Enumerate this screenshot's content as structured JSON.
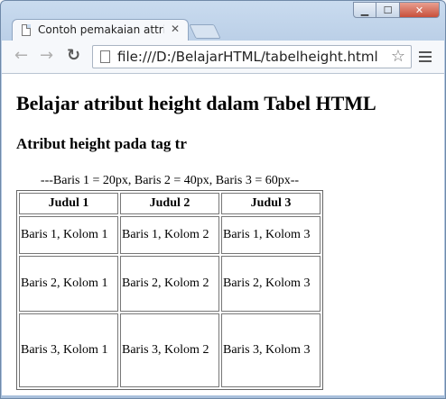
{
  "browser": {
    "tab_title": "Contoh pemakaian attribu",
    "tab_close": "✕",
    "url": "file:///D:/BelajarHTML/tabelheight.html",
    "window_controls": {
      "minimize": "▁",
      "maximize": "☐",
      "close": "✕"
    }
  },
  "page": {
    "heading": "Belajar atribut height dalam Tabel HTML",
    "subheading": "Atribut height pada tag tr",
    "table": {
      "caption": "---Baris 1 = 20px, Baris 2 = 40px, Baris 3 = 60px--",
      "headers": [
        "Judul 1",
        "Judul 2",
        "Judul 3"
      ],
      "rows": [
        [
          "Baris 1, Kolom 1",
          "Baris 1, Kolom 2",
          "Baris 1, Kolom 3"
        ],
        [
          "Baris 2, Kolom 1",
          "Baris 2, Kolom 2",
          "Baris 2, Kolom 3"
        ],
        [
          "Baris 3, Kolom 1",
          "Baris 3, Kolom 2",
          "Baris 3, Kolom 3"
        ]
      ]
    }
  },
  "icons": {
    "back": "back-arrow-icon",
    "forward": "forward-arrow-icon",
    "reload": "reload-icon",
    "bookmark": "star-icon",
    "menu": "hamburger-menu-icon"
  }
}
